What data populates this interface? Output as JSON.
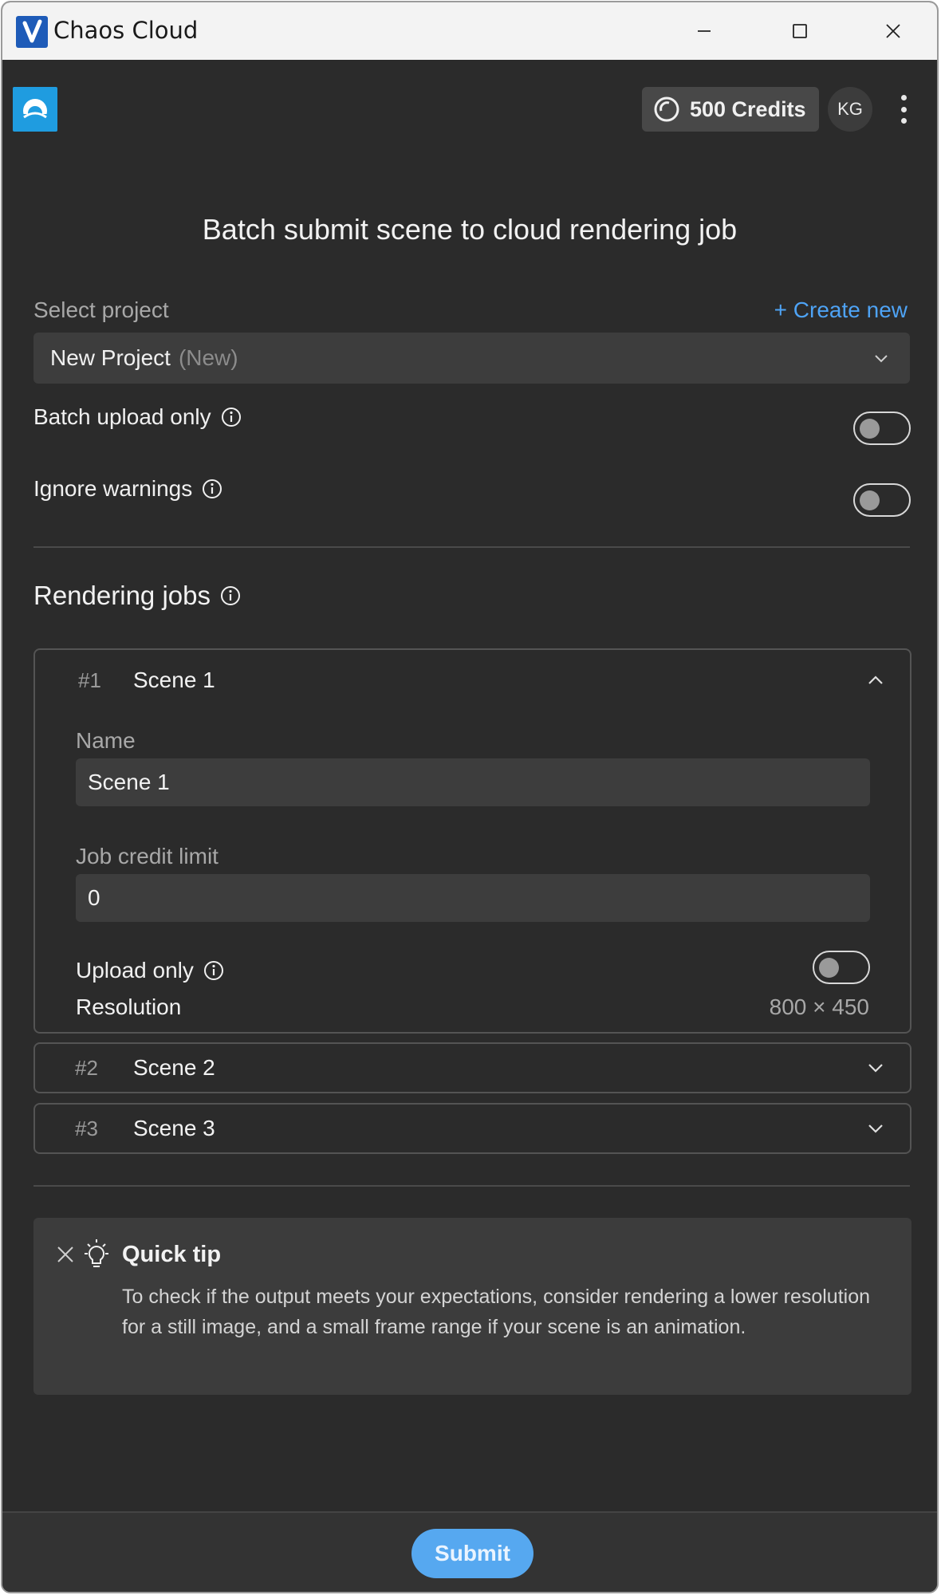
{
  "window": {
    "title": "Chaos Cloud"
  },
  "header": {
    "credits": "500 Credits",
    "avatar": "KG"
  },
  "page": {
    "heading": "Batch submit scene to cloud rendering job"
  },
  "project": {
    "label": "Select project",
    "create_new": "+ Create new",
    "selected": "New Project",
    "selected_tag": "(New)"
  },
  "options": {
    "batch_upload_only": {
      "label": "Batch upload only",
      "on": false
    },
    "ignore_warnings": {
      "label": "Ignore warnings",
      "on": false
    }
  },
  "jobs": {
    "title": "Rendering jobs",
    "items": [
      {
        "num": "#1",
        "name": "Scene 1",
        "expanded": true,
        "name_label": "Name",
        "name_value": "Scene 1",
        "credit_label": "Job credit limit",
        "credit_value": "0",
        "upload_only_label": "Upload only",
        "upload_only_on": false,
        "resolution_label": "Resolution",
        "resolution_value": "800 × 450"
      },
      {
        "num": "#2",
        "name": "Scene 2",
        "expanded": false
      },
      {
        "num": "#3",
        "name": "Scene 3",
        "expanded": false
      }
    ]
  },
  "tip": {
    "title": "Quick tip",
    "text": "To check if the output meets your expectations, consider rendering a lower resolution for a still image, and a small frame range if your scene is an animation."
  },
  "footer": {
    "submit": "Submit"
  },
  "colors": {
    "accent": "#4ea3f5",
    "submit_bg": "#56a8f0",
    "logo_bg": "#1f9ce0"
  },
  "icons": [
    "chaos-logo-icon",
    "credits-icon",
    "info-icon",
    "chevron-down-icon",
    "chevron-up-icon",
    "close-icon",
    "lightbulb-icon",
    "more-vertical-icon"
  ]
}
